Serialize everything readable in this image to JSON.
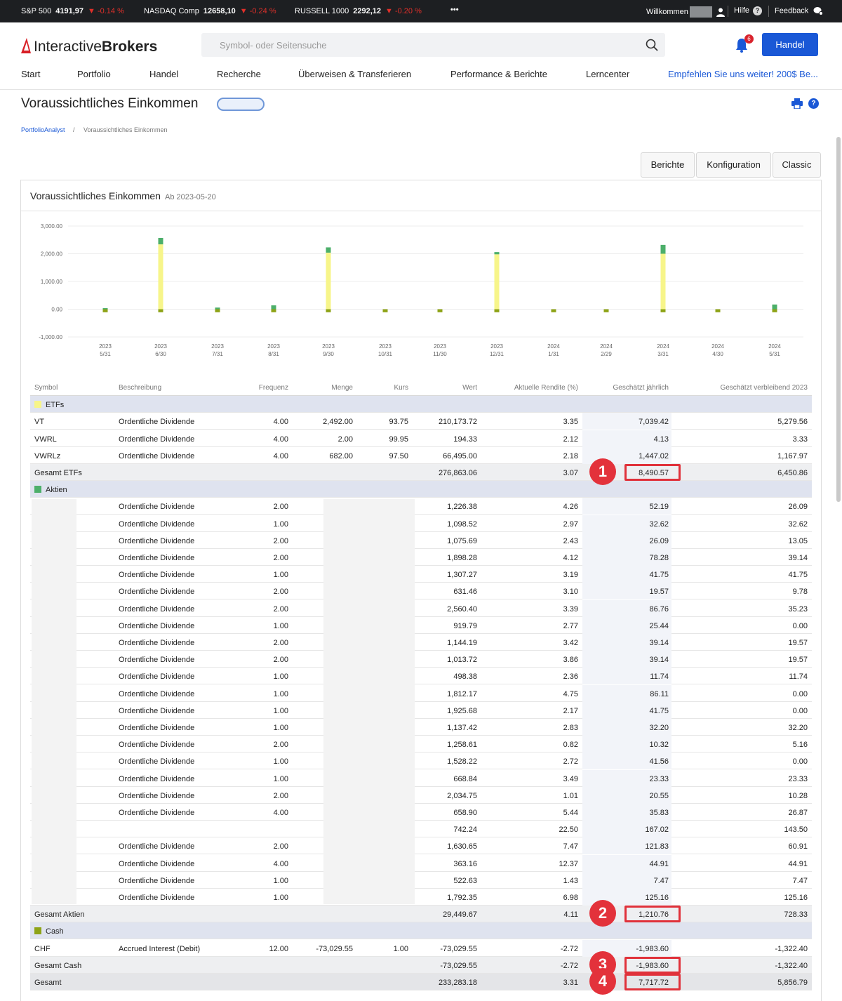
{
  "ticker": {
    "items": [
      {
        "name": "S&P 500",
        "value": "4191,97",
        "change": "▼ -0.14 %"
      },
      {
        "name": "NASDAQ Comp",
        "value": "12658,10",
        "change": "▼ -0.24 %"
      },
      {
        "name": "RUSSELL 1000",
        "value": "2292,12",
        "change": "▼ -0.20 %"
      }
    ],
    "more": "•••",
    "welcome": "Willkommen",
    "help": "Hilfe",
    "feedback": "Feedback"
  },
  "header": {
    "logo_a": "Interactive",
    "logo_b": "Brokers",
    "search_placeholder": "Symbol- oder Seitensuche",
    "notifications": "6",
    "trade_button": "Handel",
    "nav": [
      "Start",
      "Portfolio",
      "Handel",
      "Recherche",
      "Überweisen & Transferieren",
      "Performance & Berichte",
      "Lerncenter",
      "Empfehlen Sie uns weiter! 200$ Be..."
    ]
  },
  "page": {
    "title": "Voraussichtliches Einkommen",
    "breadcrumb": [
      "PortfolioAnalyst",
      "Voraussichtliches Einkommen"
    ],
    "breadcrumb_sep": "/",
    "buttons": [
      "Berichte",
      "Konfiguration",
      "Classic"
    ],
    "panel_title": "Voraussichtliches Einkommen",
    "panel_date": "Ab 2023-05-20"
  },
  "chart_data": {
    "type": "bar",
    "y_ticks": [
      "3,000.00",
      "2,000.00",
      "1,000.00",
      "0.00",
      "-1,000.00"
    ],
    "ylim": [
      -1000,
      3000
    ],
    "categories": [
      [
        "2023",
        "5/31"
      ],
      [
        "2023",
        "6/30"
      ],
      [
        "2023",
        "7/31"
      ],
      [
        "2023",
        "8/31"
      ],
      [
        "2023",
        "9/30"
      ],
      [
        "2023",
        "10/31"
      ],
      [
        "2023",
        "11/30"
      ],
      [
        "2023",
        "12/31"
      ],
      [
        "2024",
        "1/31"
      ],
      [
        "2024",
        "2/29"
      ],
      [
        "2024",
        "3/31"
      ],
      [
        "2024",
        "4/30"
      ],
      [
        "2024",
        "5/31"
      ]
    ],
    "series": [
      {
        "name": "ETFs",
        "color": "#f7f58a",
        "values": [
          0,
          2340,
          0,
          0,
          2040,
          0,
          0,
          1980,
          0,
          0,
          2000,
          0,
          0
        ]
      },
      {
        "name": "Aktien",
        "color": "#4caf6a",
        "values": [
          40,
          230,
          60,
          140,
          190,
          0,
          0,
          80,
          0,
          0,
          320,
          0,
          170
        ]
      },
      {
        "name": "Cash",
        "color": "#8ea317",
        "values": [
          -110,
          -110,
          -110,
          -110,
          -110,
          -110,
          -110,
          -110,
          -110,
          -110,
          -110,
          -110,
          -110
        ]
      }
    ]
  },
  "table": {
    "headers": [
      "Symbol",
      "Beschreibung",
      "Frequenz",
      "Menge",
      "Kurs",
      "Wert",
      "Aktuelle Rendite (%)",
      "Geschätzt jährlich",
      "Geschätzt verbleibend 2023"
    ],
    "etf_group": "ETFs",
    "etf_rows": [
      {
        "sym": "VT",
        "desc": "Ordentliche Dividende",
        "freq": "4.00",
        "qty": "2,492.00",
        "price": "93.75",
        "value": "210,173.72",
        "yield": "3.35",
        "est": "7,039.42",
        "rem": "5,279.56"
      },
      {
        "sym": "VWRL",
        "desc": "Ordentliche Dividende",
        "freq": "4.00",
        "qty": "2.00",
        "price": "99.95",
        "value": "194.33",
        "yield": "2.12",
        "est": "4.13",
        "rem": "3.33"
      },
      {
        "sym": "VWRLz",
        "desc": "Ordentliche Dividende",
        "freq": "4.00",
        "qty": "682.00",
        "price": "97.50",
        "value": "66,495.00",
        "yield": "2.18",
        "est": "1,447.02",
        "rem": "1,167.97"
      }
    ],
    "etf_total": {
      "label": "Gesamt ETFs",
      "value": "276,863.06",
      "yield": "3.07",
      "est": "8,490.57",
      "rem": "6,450.86"
    },
    "stock_group": "Aktien",
    "stock_rows": [
      {
        "desc": "Ordentliche Dividende",
        "freq": "2.00",
        "value": "1,226.38",
        "yield": "4.26",
        "est": "52.19",
        "rem": "26.09"
      },
      {
        "desc": "Ordentliche Dividende",
        "freq": "1.00",
        "value": "1,098.52",
        "yield": "2.97",
        "est": "32.62",
        "rem": "32.62"
      },
      {
        "desc": "Ordentliche Dividende",
        "freq": "2.00",
        "value": "1,075.69",
        "yield": "2.43",
        "est": "26.09",
        "rem": "13.05"
      },
      {
        "desc": "Ordentliche Dividende",
        "freq": "2.00",
        "value": "1,898.28",
        "yield": "4.12",
        "est": "78.28",
        "rem": "39.14"
      },
      {
        "desc": "Ordentliche Dividende",
        "freq": "1.00",
        "value": "1,307.27",
        "yield": "3.19",
        "est": "41.75",
        "rem": "41.75"
      },
      {
        "desc": "Ordentliche Dividende",
        "freq": "2.00",
        "value": "631.46",
        "yield": "3.10",
        "est": "19.57",
        "rem": "9.78"
      },
      {
        "desc": "Ordentliche Dividende",
        "freq": "2.00",
        "value": "2,560.40",
        "yield": "3.39",
        "est": "86.76",
        "rem": "35.23"
      },
      {
        "desc": "Ordentliche Dividende",
        "freq": "1.00",
        "value": "919.79",
        "yield": "2.77",
        "est": "25.44",
        "rem": "0.00"
      },
      {
        "desc": "Ordentliche Dividende",
        "freq": "2.00",
        "value": "1,144.19",
        "yield": "3.42",
        "est": "39.14",
        "rem": "19.57"
      },
      {
        "desc": "Ordentliche Dividende",
        "freq": "2.00",
        "value": "1,013.72",
        "yield": "3.86",
        "est": "39.14",
        "rem": "19.57"
      },
      {
        "desc": "Ordentliche Dividende",
        "freq": "1.00",
        "value": "498.38",
        "yield": "2.36",
        "est": "11.74",
        "rem": "11.74"
      },
      {
        "desc": "Ordentliche Dividende",
        "freq": "1.00",
        "value": "1,812.17",
        "yield": "4.75",
        "est": "86.11",
        "rem": "0.00"
      },
      {
        "desc": "Ordentliche Dividende",
        "freq": "1.00",
        "value": "1,925.68",
        "yield": "2.17",
        "est": "41.75",
        "rem": "0.00"
      },
      {
        "desc": "Ordentliche Dividende",
        "freq": "1.00",
        "value": "1,137.42",
        "yield": "2.83",
        "est": "32.20",
        "rem": "32.20"
      },
      {
        "desc": "Ordentliche Dividende",
        "freq": "2.00",
        "value": "1,258.61",
        "yield": "0.82",
        "est": "10.32",
        "rem": "5.16"
      },
      {
        "desc": "Ordentliche Dividende",
        "freq": "1.00",
        "value": "1,528.22",
        "yield": "2.72",
        "est": "41.56",
        "rem": "0.00"
      },
      {
        "desc": "Ordentliche Dividende",
        "freq": "1.00",
        "value": "668.84",
        "yield": "3.49",
        "est": "23.33",
        "rem": "23.33"
      },
      {
        "desc": "Ordentliche Dividende",
        "freq": "2.00",
        "value": "2,034.75",
        "yield": "1.01",
        "est": "20.55",
        "rem": "10.28"
      },
      {
        "desc": "Ordentliche Dividende",
        "freq": "4.00",
        "value": "658.90",
        "yield": "5.44",
        "est": "35.83",
        "rem": "26.87"
      },
      {
        "desc": "",
        "freq": "",
        "value": "742.24",
        "yield": "22.50",
        "est": "167.02",
        "rem": "143.50"
      },
      {
        "desc": "Ordentliche Dividende",
        "freq": "2.00",
        "value": "1,630.65",
        "yield": "7.47",
        "est": "121.83",
        "rem": "60.91"
      },
      {
        "desc": "Ordentliche Dividende",
        "freq": "4.00",
        "value": "363.16",
        "yield": "12.37",
        "est": "44.91",
        "rem": "44.91"
      },
      {
        "desc": "Ordentliche Dividende",
        "freq": "1.00",
        "value": "522.63",
        "yield": "1.43",
        "est": "7.47",
        "rem": "7.47"
      },
      {
        "desc": "Ordentliche Dividende",
        "freq": "1.00",
        "value": "1,792.35",
        "yield": "6.98",
        "est": "125.16",
        "rem": "125.16"
      }
    ],
    "stock_total": {
      "label": "Gesamt Aktien",
      "value": "29,449.67",
      "yield": "4.11",
      "est": "1,210.76",
      "rem": "728.33"
    },
    "cash_group": "Cash",
    "cash_row": {
      "sym": "CHF",
      "desc": "Accrued Interest (Debit)",
      "freq": "12.00",
      "qty": "-73,029.55",
      "price": "1.00",
      "value": "-73,029.55",
      "yield": "-2.72",
      "est": "-1,983.60",
      "rem": "-1,322.40"
    },
    "cash_total": {
      "label": "Gesamt Cash",
      "value": "-73,029.55",
      "yield": "-2.72",
      "est": "-1,983.60",
      "rem": "-1,322.40"
    },
    "grand_total": {
      "label": "Gesamt",
      "value": "233,283.18",
      "yield": "3.31",
      "est": "7,717.72",
      "rem": "5,856.79"
    }
  },
  "annotations": [
    "1",
    "2",
    "3",
    "4"
  ]
}
